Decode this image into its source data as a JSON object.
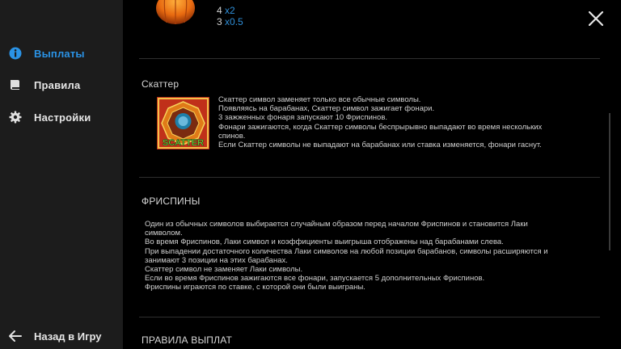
{
  "sidebar": {
    "items": [
      {
        "label": "Выплаты",
        "icon": "info-icon",
        "active": true
      },
      {
        "label": "Правила",
        "icon": "book-icon",
        "active": false
      },
      {
        "label": "Настройки",
        "icon": "gear-icon",
        "active": false
      }
    ],
    "back_label": "Назад в Игру"
  },
  "paytable": {
    "rows": [
      {
        "count": "4",
        "multiplier": "x2"
      },
      {
        "count": "3",
        "multiplier": "x0.5"
      }
    ]
  },
  "scatter": {
    "title": "Скаттер",
    "symbol_label": "SCATTER",
    "lines": [
      "Скаттер символ заменяет только все обычные символы.",
      "Появляясь на барабанах, Скаттер символ зажигает фонари.",
      "3 зажженных фонаря запускают 10 Фриспинов.",
      "Фонари зажигаются, когда Скаттер символы беспрырывно выпадают во время нескольких",
      "спинов.",
      "Если Скаттер символы не выпадают на барабанах или ставка изменяется, фонари гаснут."
    ]
  },
  "freespins": {
    "title": "ФРИСПИНЫ",
    "lines": [
      "Один из обычных символов выбирается случайным образом перед началом Фриспинов и становится Лаки",
      "символом.",
      "Во время Фриспинов, Лаки символ и коэффициенты выигрыша отображены над барабанами слева.",
      "При выпадении достаточного количества Лаки символов на любой позиции барабанов, символы расширяются и",
      "занимают 3 позиции на этих барабанах.",
      "Скаттер символ не заменяет Лаки символы.",
      "Если во время Фриспинов зажигаются все фонари, запускается 5 дополнительных Фриспинов.",
      "Фриспины играются по ставке, с которой они были выиграны."
    ]
  },
  "payout_rules": {
    "title": "ПРАВИЛА ВЫПЛАТ"
  },
  "colors": {
    "accent": "#2a93e6",
    "sidebar_bg": "#1c1c1c",
    "content_bg": "#000000"
  }
}
